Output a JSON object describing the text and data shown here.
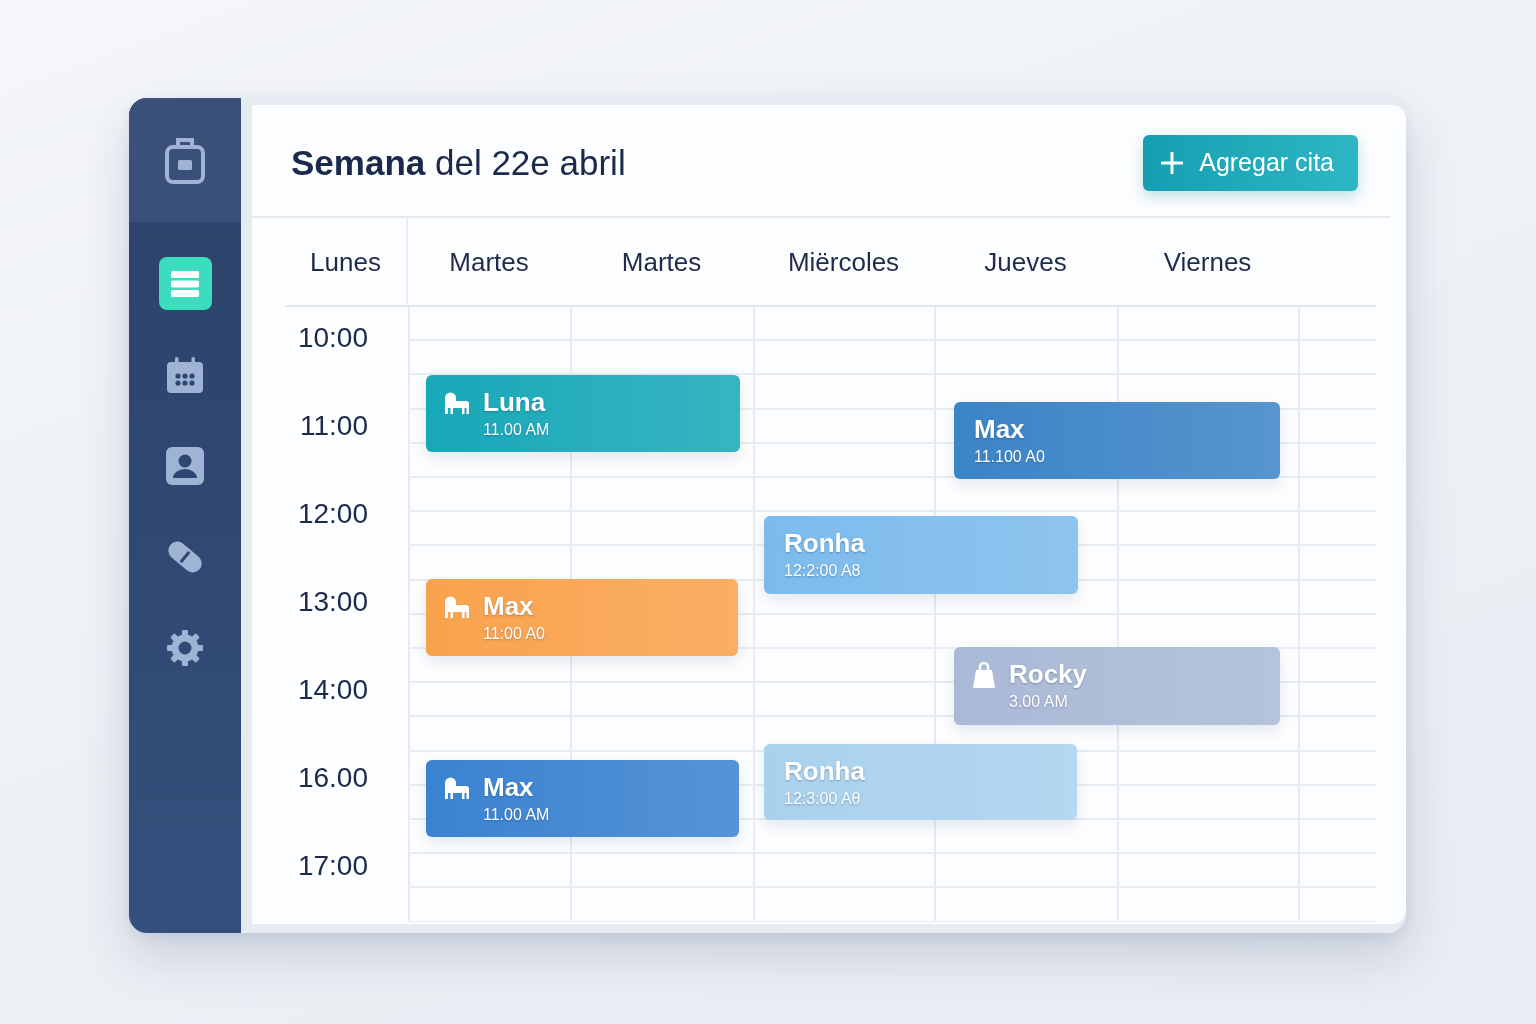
{
  "sidebar": {
    "items": [
      {
        "selected": true
      },
      {
        "selected": false
      },
      {
        "selected": false
      },
      {
        "selected": false
      },
      {
        "selected": false
      }
    ]
  },
  "header": {
    "title": "**Semana** del 22e abril",
    "add_button": "Agregar cita"
  },
  "calendar": {
    "days": [
      "Lunes",
      "Martes",
      "Martes",
      "Miërcoles",
      "Jueves",
      "Viernes"
    ],
    "times": [
      "10:00",
      "11:00",
      "12:00",
      "13:00",
      "14:00",
      "16.00",
      "17:00"
    ],
    "events": [
      {
        "name": "Luna",
        "time": "11.00 AM",
        "kind": "animal",
        "color": "#17a8b8"
      },
      {
        "name": "Max",
        "time": "11.100 A0",
        "kind": "plain",
        "color": "#3b84c6"
      },
      {
        "name": "Ronha",
        "time": "12:2:00 A8",
        "kind": "plain",
        "color": "#7cbbec"
      },
      {
        "name": "Max",
        "time": "11:00 A0",
        "kind": "animal",
        "color": "#f9a24c"
      },
      {
        "name": "Rocky",
        "time": "3.00 AM",
        "kind": "bag",
        "color": "#aab9d6"
      },
      {
        "name": "Ronha",
        "time": "12:3:00 Aθ",
        "kind": "plain",
        "color": "#a9d1ee"
      },
      {
        "name": "Max",
        "time": "11.00 AM",
        "kind": "animal",
        "color": "#3a82d0"
      }
    ]
  }
}
